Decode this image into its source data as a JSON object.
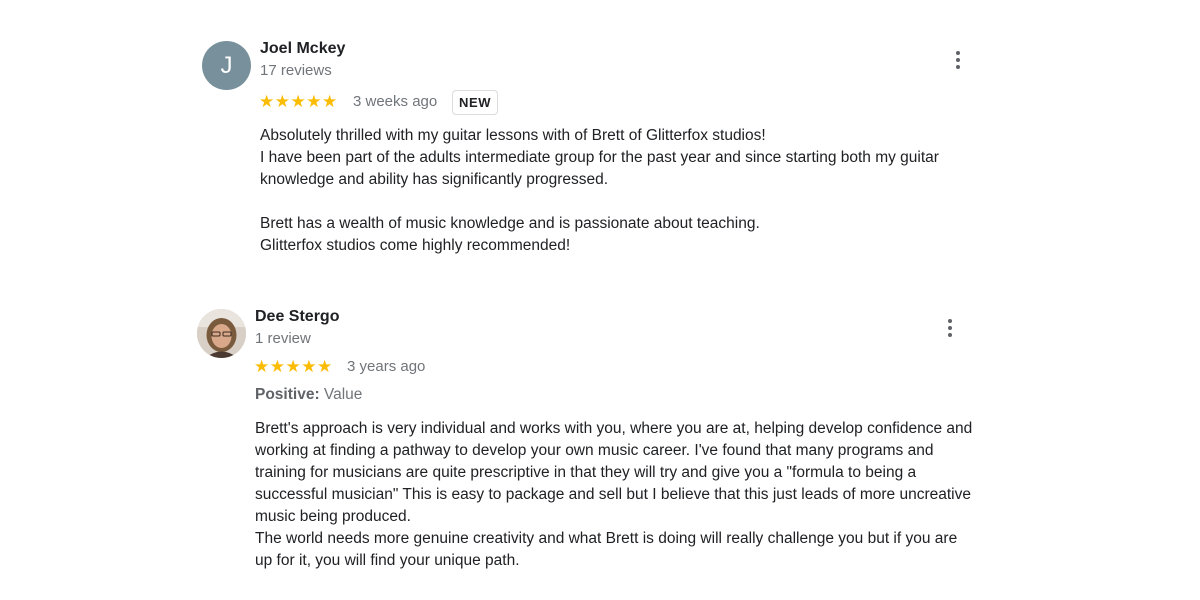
{
  "reviews": [
    {
      "avatar_letter": "J",
      "avatar_color": "#78909c",
      "name": "Joel Mckey",
      "review_count": "17 reviews",
      "rating": 5,
      "stars": "★★★★★",
      "age": "3 weeks ago",
      "badge": "NEW",
      "icon": "more-vert-icon",
      "lines": [
        "Absolutely thrilled with my guitar lessons with of Brett of Glitterfox studios!",
        "I have been part of the adults intermediate group for the past year and since starting both my guitar",
        "knowledge and ability has significantly progressed.",
        "Brett has a wealth of music knowledge and is passionate about teaching.",
        "Glitterfox studios come highly recommended!"
      ]
    },
    {
      "name": "Dee Stergo",
      "review_count": "1 review",
      "rating": 5,
      "stars": "★★★★★",
      "age": "3 years ago",
      "attribute_label": "Positive:",
      "attribute_value": "Value",
      "icon": "more-vert-icon",
      "lines": [
        "Brett's approach is very individual and works with you, where you are at, helping develop confidence and",
        "working at finding a pathway to develop your own music career. I've found that many programs and",
        "training for musicians are quite prescriptive in that they will try and give you a \"formula to being a",
        "successful musician\" This is easy to package and sell but I believe that this just leads of more uncreative",
        "music being produced.",
        "The world needs more genuine creativity and what Brett is doing will really challenge you but if you are",
        "up for it, you will find your unique path."
      ]
    }
  ],
  "colors": {
    "star": "#fbbc04",
    "secondary_text": "#70757a",
    "badge_border": "#dadce0"
  }
}
